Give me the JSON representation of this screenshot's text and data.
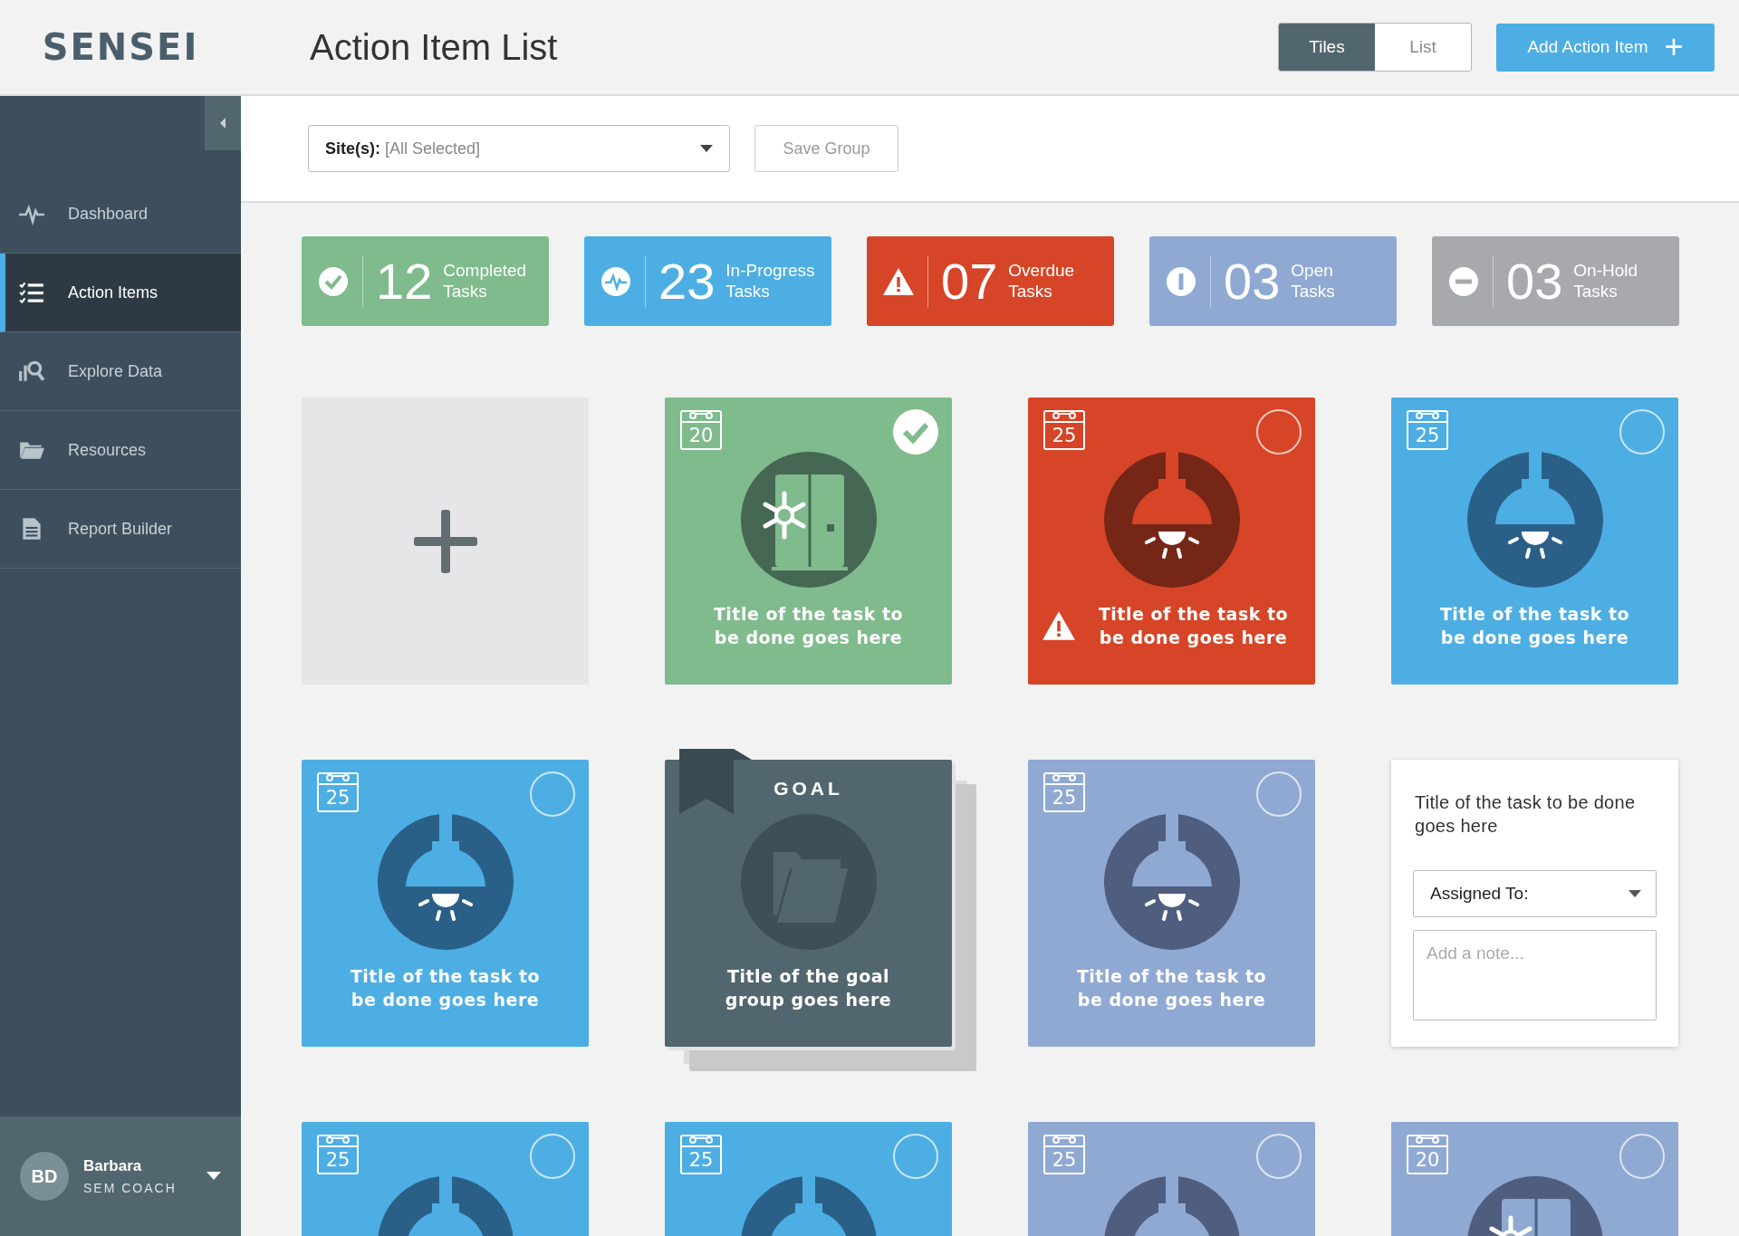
{
  "logo": "SENSEI",
  "title": "Action Item List",
  "view_toggle": [
    {
      "label": "Tiles",
      "selected": true
    },
    {
      "label": "List",
      "selected": false
    }
  ],
  "add_button": {
    "label": "Add Action Item",
    "icon": "+"
  },
  "sidebar": {
    "items": [
      {
        "label": "Dashboard",
        "selected": false
      },
      {
        "label": "Action Items",
        "selected": true
      },
      {
        "label": "Explore Data",
        "selected": false
      },
      {
        "label": "Resources",
        "selected": false
      },
      {
        "label": "Report Builder",
        "selected": false
      }
    ],
    "user": {
      "initials": "BD",
      "name": "Barbara",
      "role": "SEM COACH"
    }
  },
  "filter": {
    "label": "Site(s):",
    "value": "[All Selected]",
    "save_button": "Save Group"
  },
  "stats": [
    {
      "kind": "check",
      "color": "#7fbb8c",
      "count": "12",
      "label": "Completed",
      "sublabel": "Tasks"
    },
    {
      "kind": "pulse",
      "color": "#4daee3",
      "count": "23",
      "label": "In-Progress",
      "sublabel": "Tasks"
    },
    {
      "kind": "warning",
      "color": "#d64527",
      "count": "07",
      "label": "Overdue",
      "sublabel": "Tasks"
    },
    {
      "kind": "info",
      "color": "#8fa9d3",
      "count": "03",
      "label": "Open",
      "sublabel": "Tasks"
    },
    {
      "kind": "minus",
      "color": "#a8a9ad",
      "count": "03",
      "label": "On-Hold",
      "sublabel": "Tasks"
    }
  ],
  "tiles": [
    {
      "kind": "add"
    },
    {
      "kind": "fridge",
      "color": "#7fbb8c",
      "date": "20",
      "checked": true,
      "overdue": false,
      "title": "Title of the task to be done goes here"
    },
    {
      "kind": "lamp",
      "color": "#d64527",
      "date": "25",
      "checked": false,
      "overdue": true,
      "title": "Title of the task to be done goes here"
    },
    {
      "kind": "lamp",
      "color": "#4daee3",
      "date": "25",
      "checked": false,
      "overdue": false,
      "title": "Title of the task to be done goes here"
    },
    {
      "kind": "lamp",
      "color": "#4daee3",
      "date": "25",
      "checked": false,
      "overdue": false,
      "title": "Title of the task to be done goes here"
    },
    {
      "kind": "goal",
      "label": "GOAL",
      "title": "Title of the goal group goes here"
    },
    {
      "kind": "lamp",
      "color": "#8fa9d3",
      "date": "25",
      "checked": false,
      "overdue": false,
      "title": "Title of the task to be done goes here"
    },
    {
      "kind": "form",
      "title": "Title of the task to be done goes here",
      "assigned_label": "Assigned To:",
      "note_placeholder": "Add a note..."
    },
    {
      "kind": "lamp",
      "color": "#4daee3",
      "date": "25",
      "checked": false
    },
    {
      "kind": "lamp",
      "color": "#4daee3",
      "date": "25",
      "checked": false
    },
    {
      "kind": "lamp",
      "color": "#8fa9d3",
      "date": "25",
      "checked": false
    },
    {
      "kind": "fridge",
      "color": "#8fa9d3",
      "date": "20",
      "checked": false
    }
  ]
}
